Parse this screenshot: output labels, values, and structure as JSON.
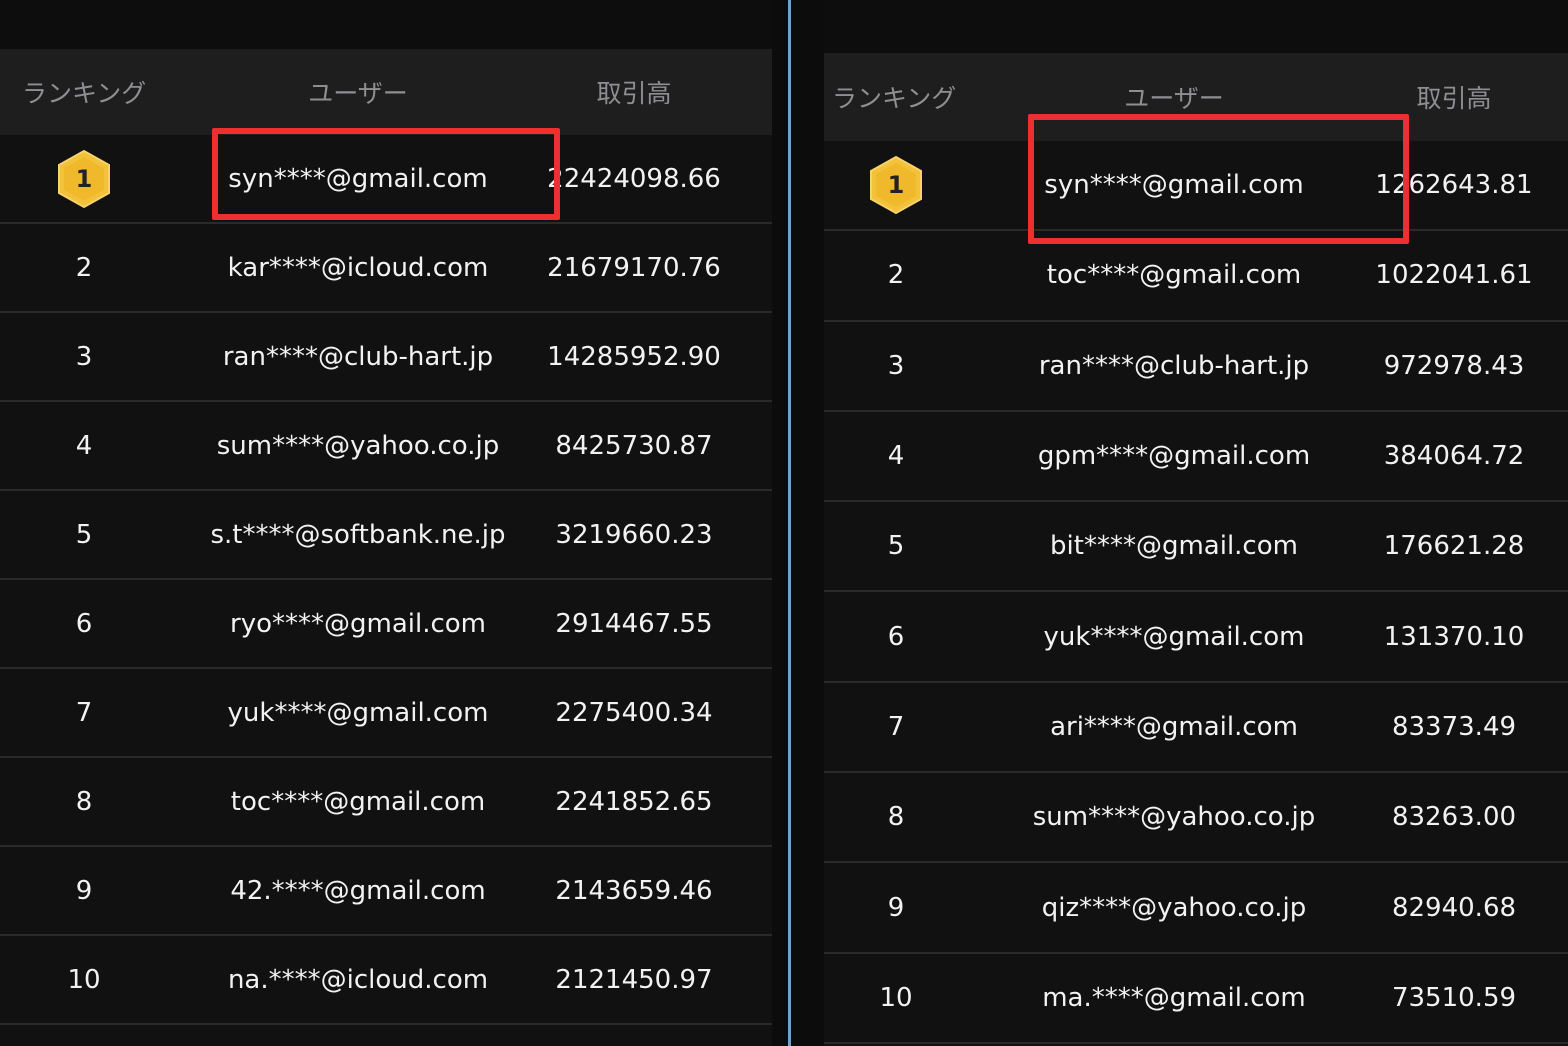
{
  "colors": {
    "background": "#111112",
    "header_background": "#1e1e1f",
    "header_text": "#8f8f93",
    "row_text": "#f2f2f2",
    "row_separator": "#2a2a2c",
    "badge_fill": "#f3c23b",
    "highlight": "#ee2f2f",
    "divider": "#6fa4c8"
  },
  "left": {
    "headers": {
      "rank": "ランキング",
      "user": "ユーザー",
      "volume": "取引高"
    },
    "rows": [
      {
        "rank": "1",
        "user": "syn****@gmail.com",
        "volume": "22424098.66",
        "badge": "gold-hexagon-medal"
      },
      {
        "rank": "2",
        "user": "kar****@icloud.com",
        "volume": "21679170.76"
      },
      {
        "rank": "3",
        "user": "ran****@club-hart.jp",
        "volume": "14285952.90"
      },
      {
        "rank": "4",
        "user": "sum****@yahoo.co.jp",
        "volume": "8425730.87"
      },
      {
        "rank": "5",
        "user": "s.t****@softbank.ne.jp",
        "volume": "3219660.23"
      },
      {
        "rank": "6",
        "user": "ryo****@gmail.com",
        "volume": "2914467.55"
      },
      {
        "rank": "7",
        "user": "yuk****@gmail.com",
        "volume": "2275400.34"
      },
      {
        "rank": "8",
        "user": "toc****@gmail.com",
        "volume": "2241852.65"
      },
      {
        "rank": "9",
        "user": "42.****@gmail.com",
        "volume": "2143659.46"
      },
      {
        "rank": "10",
        "user": "na.****@icloud.com",
        "volume": "2121450.97"
      }
    ]
  },
  "right": {
    "headers": {
      "rank": "ランキング",
      "user": "ユーザー",
      "volume": "取引高"
    },
    "rows": [
      {
        "rank": "1",
        "user": "syn****@gmail.com",
        "volume": "1262643.81",
        "badge": "gold-hexagon-medal"
      },
      {
        "rank": "2",
        "user": "toc****@gmail.com",
        "volume": "1022041.61"
      },
      {
        "rank": "3",
        "user": "ran****@club-hart.jp",
        "volume": "972978.43"
      },
      {
        "rank": "4",
        "user": "gpm****@gmail.com",
        "volume": "384064.72"
      },
      {
        "rank": "5",
        "user": "bit****@gmail.com",
        "volume": "176621.28"
      },
      {
        "rank": "6",
        "user": "yuk****@gmail.com",
        "volume": "131370.10"
      },
      {
        "rank": "7",
        "user": "ari****@gmail.com",
        "volume": "83373.49"
      },
      {
        "rank": "8",
        "user": "sum****@yahoo.co.jp",
        "volume": "83263.00"
      },
      {
        "rank": "9",
        "user": "qiz****@yahoo.co.jp",
        "volume": "82940.68"
      },
      {
        "rank": "10",
        "user": "ma.****@gmail.com",
        "volume": "73510.59"
      }
    ]
  }
}
